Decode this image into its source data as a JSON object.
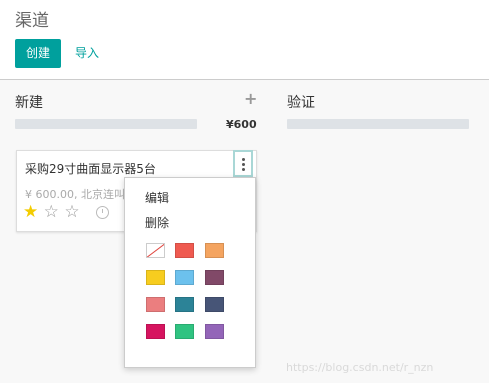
{
  "control_panel": {
    "title": "渠道",
    "create_label": "创建",
    "import_label": "导入"
  },
  "columns": [
    {
      "title": "新建",
      "add_icon": "+",
      "total": "¥600"
    },
    {
      "title": "验证"
    }
  ],
  "card": {
    "title": "采购29寸曲面显示器5台",
    "subtitle": "¥ 600.00, 北京连叫",
    "rating": 1,
    "rating_max": 3
  },
  "dropdown": {
    "edit_label": "编辑",
    "delete_label": "删除",
    "colors": [
      "none",
      "#ef5a50",
      "#f4a460",
      "#f7cd1f",
      "#6cc1ed",
      "#814968",
      "#eb7e7f",
      "#2c8397",
      "#475577",
      "#d6145f",
      "#30c381",
      "#9365b8"
    ]
  },
  "watermark": "https://blog.csdn.net/r_nzn"
}
